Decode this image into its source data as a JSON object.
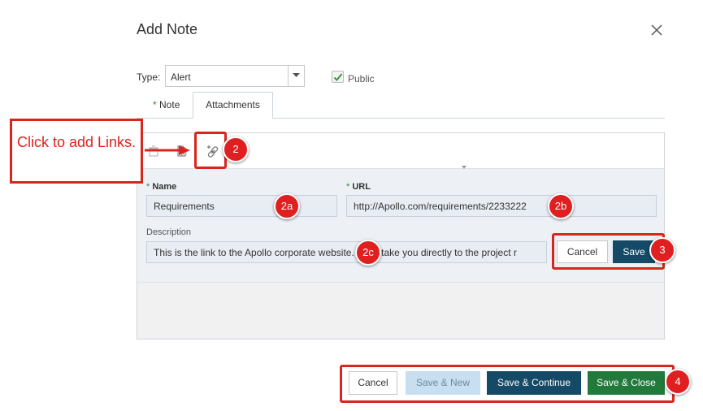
{
  "dialog": {
    "title": "Add Note"
  },
  "form": {
    "type_label": "Type:",
    "type_value": "Alert",
    "public_label": "Public",
    "public_checked": true
  },
  "tabs": [
    {
      "label": "Note",
      "required": true,
      "active": false
    },
    {
      "label": "Attachments",
      "required": false,
      "active": true
    }
  ],
  "toolbar": {
    "icons": [
      "delete-icon",
      "add-file-icon",
      "add-link-icon"
    ]
  },
  "link_form": {
    "name_label": "Name",
    "name_value": "Requirements",
    "url_label": "URL",
    "url_value": "http://Apollo.com/requirements/2233222",
    "description_label": "Description",
    "description_value": "This is the link to the Apollo corporate website. It will take you directly to the project r",
    "cancel_label": "Cancel",
    "save_label": "Save"
  },
  "footer": {
    "cancel_label": "Cancel",
    "save_new_label": "Save & New",
    "save_continue_label": "Save & Continue",
    "save_close_label": "Save & Close"
  },
  "annotations": {
    "callout_text": "Click to add Links.",
    "badges": [
      "2",
      "2a",
      "2b",
      "2c",
      "3",
      "4"
    ]
  },
  "colors": {
    "accent_dark": "#144a66",
    "accent_green": "#217a3c",
    "callout_red": "#d9251d",
    "required_green": "#2e8b3a"
  }
}
